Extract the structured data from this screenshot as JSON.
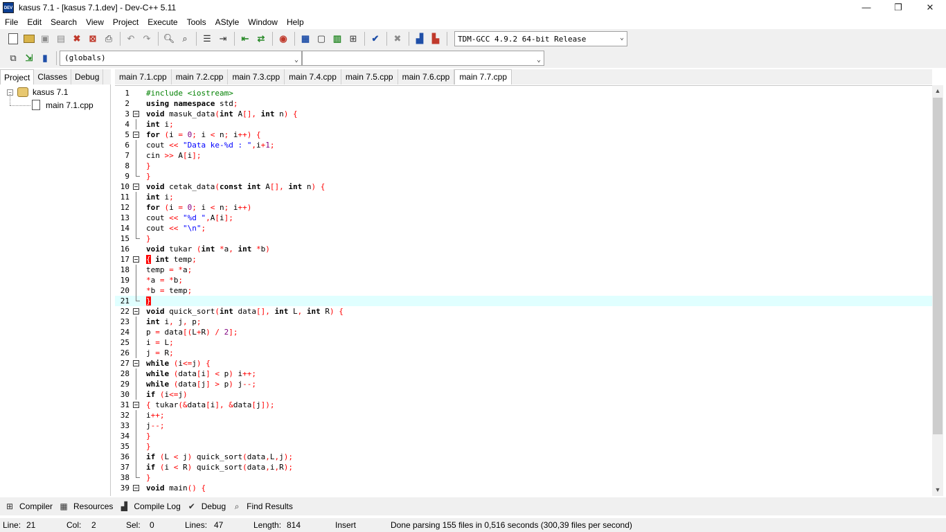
{
  "window": {
    "title": "kasus 7.1 - [kasus 7.1.dev] - Dev-C++ 5.11",
    "app_icon": "DEV",
    "minimize": "—",
    "restore": "❐",
    "close": "✕"
  },
  "menu": [
    "File",
    "Edit",
    "Search",
    "View",
    "Project",
    "Execute",
    "Tools",
    "AStyle",
    "Window",
    "Help"
  ],
  "toolbar": {
    "compiler": "TDM-GCC 4.9.2 64-bit Release",
    "icons": [
      "new-file-icon",
      "open-icon",
      "save-icon",
      "save-all-icon",
      "close-file-icon",
      "close-all-icon",
      "print-icon",
      "undo-icon",
      "redo-icon",
      "find-icon",
      "replace-icon",
      "goto-line-icon",
      "indent-icon",
      "unindent-icon",
      "toggle-comment-icon",
      "compile-icon",
      "run-icon",
      "compile-run-icon",
      "rebuild-icon",
      "check-syntax-icon",
      "stop-icon",
      "profile-icon",
      "profile-delete-icon"
    ]
  },
  "toolbar2": {
    "globals": "(globals)",
    "members": ""
  },
  "left_tabs": [
    "Project",
    "Classes",
    "Debug"
  ],
  "project_tree": {
    "root": "kasus 7.1",
    "child": "main 7.1.cpp"
  },
  "file_tabs": [
    "main 7.1.cpp",
    "main 7.2.cpp",
    "main 7.3.cpp",
    "main 7.4.cpp",
    "main 7.5.cpp",
    "main 7.6.cpp",
    "main 7.7.cpp"
  ],
  "active_tab": 6,
  "code": {
    "current_line": 21,
    "lines": [
      "#include <iostream>",
      "using namespace std;",
      "void masuk_data(int A[], int n) {",
      "int i;",
      "for (i = 0; i < n; i++) {",
      "cout << \"Data ke-%d : \",i+1;",
      "cin >> A[i];",
      "}",
      "}",
      "void cetak_data(const int A[], int n) {",
      "int i;",
      "for (i = 0; i < n; i++)",
      "cout << \"%d \",A[i];",
      "cout << \"\\n\";",
      "}",
      "void tukar (int *a, int *b)",
      "{ int temp;",
      "temp = *a;",
      "*a = *b;",
      "*b = temp;",
      "}",
      "void quick_sort(int data[], int L, int R) {",
      "int i, j, p;",
      "p = data[(L+R) / 2];",
      "i = L;",
      "j = R;",
      "while (i<=j) {",
      "while (data[i] < p) i++;",
      "while (data[j] > p) j--;",
      "if (i<=j)",
      "{ tukar(&data[i], &data[j]);",
      "i++;",
      "j--;",
      "}",
      "}",
      "if (L < j) quick_sort(data,L,j);",
      "if (i < R) quick_sort(data,i,R);",
      "}",
      "void main() {"
    ],
    "fold_open": [
      3,
      5,
      10,
      17,
      22,
      27,
      31,
      39
    ],
    "fold_end": [
      9,
      15,
      21,
      38
    ],
    "fold_guide": [
      4,
      6,
      7,
      8,
      11,
      12,
      13,
      14,
      18,
      19,
      20,
      23,
      24,
      25,
      26,
      28,
      29,
      30,
      32,
      33,
      34,
      35,
      36,
      37
    ]
  },
  "bottom_tabs": [
    {
      "label": "Compiler",
      "icon": "compiler-icon"
    },
    {
      "label": "Resources",
      "icon": "resources-icon"
    },
    {
      "label": "Compile Log",
      "icon": "compile-log-icon"
    },
    {
      "label": "Debug",
      "icon": "debug-icon"
    },
    {
      "label": "Find Results",
      "icon": "find-results-icon"
    }
  ],
  "status": {
    "line_label": "Line:",
    "line": "21",
    "col_label": "Col:",
    "col": "2",
    "sel_label": "Sel:",
    "sel": "0",
    "lines_label": "Lines:",
    "lines": "47",
    "length_label": "Length:",
    "length": "814",
    "mode": "Insert",
    "message": "Done parsing 155 files in 0,516 seconds (300,39 files per second)"
  }
}
